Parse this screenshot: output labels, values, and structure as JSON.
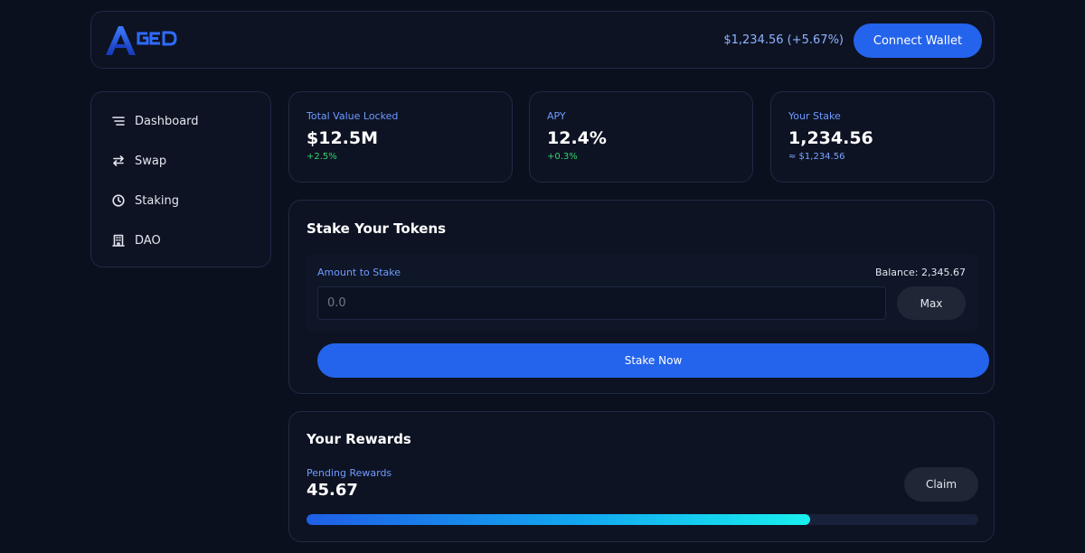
{
  "colors": {
    "background": "#0b101e",
    "card": "#0d1323",
    "accent": "#2463eb",
    "label_blue": "#6e9bff",
    "positive_green": "#34d36b"
  },
  "header": {
    "logo": {
      "name": "aged-finance-logo"
    },
    "balance_text": "$1,234.56 (+5.67%)",
    "connect_label": "Connect Wallet"
  },
  "sidebar": {
    "items": [
      {
        "label": "Dashboard",
        "icon": "menu-lines-icon"
      },
      {
        "label": "Swap",
        "icon": "swap-arrows-icon"
      },
      {
        "label": "Staking",
        "icon": "clock-icon"
      },
      {
        "label": "DAO",
        "icon": "building-icon"
      }
    ]
  },
  "stats": [
    {
      "label": "Total Value Locked",
      "value": "$12.5M",
      "sub": "+2.5%"
    },
    {
      "label": "APY",
      "value": "12.4%",
      "sub": "+0.3%"
    },
    {
      "label": "Your Stake",
      "value": "1,234.56",
      "sub": "≈ $1,234.56"
    }
  ],
  "stake": {
    "title": "Stake Your Tokens",
    "amount_label": "Amount to Stake",
    "balance_label": "Balance: 2,345.67",
    "input_placeholder": "0.0",
    "max_label": "Max",
    "stake_button": "Stake Now"
  },
  "rewards": {
    "title": "Your Rewards",
    "pending_label": "Pending Rewards",
    "pending_value": "45.67",
    "claim_label": "Claim",
    "progress_fraction": 0.75
  }
}
